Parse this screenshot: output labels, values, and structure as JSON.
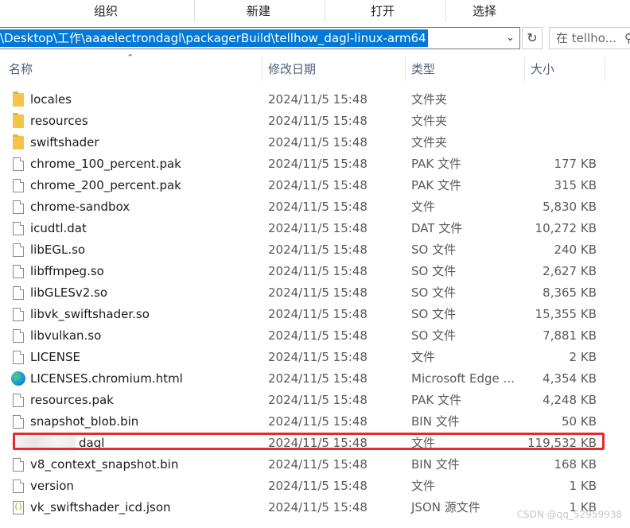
{
  "ribbon": {
    "groups": [
      "组织",
      "新建",
      "打开",
      "选择"
    ]
  },
  "address": {
    "path": "\\Desktop\\工作\\aaaelectrondagl\\packagerBuild\\tellhow_dagl-linux-arm64",
    "dropdown_icon": "chevron-down-icon",
    "refresh_icon": "refresh-icon",
    "search_placeholder": "在 tellho...",
    "search_icon": "search-icon"
  },
  "columns": {
    "name": "名称",
    "date": "修改日期",
    "type": "类型",
    "size": "大小"
  },
  "files": [
    {
      "name": "locales",
      "date": "2024/11/5 15:48",
      "type": "文件夹",
      "size": "",
      "icon": "folder"
    },
    {
      "name": "resources",
      "date": "2024/11/5 15:48",
      "type": "文件夹",
      "size": "",
      "icon": "folder"
    },
    {
      "name": "swiftshader",
      "date": "2024/11/5 15:48",
      "type": "文件夹",
      "size": "",
      "icon": "folder"
    },
    {
      "name": "chrome_100_percent.pak",
      "date": "2024/11/5 15:48",
      "type": "PAK 文件",
      "size": "177 KB",
      "icon": "file"
    },
    {
      "name": "chrome_200_percent.pak",
      "date": "2024/11/5 15:48",
      "type": "PAK 文件",
      "size": "315 KB",
      "icon": "file"
    },
    {
      "name": "chrome-sandbox",
      "date": "2024/11/5 15:48",
      "type": "文件",
      "size": "5,830 KB",
      "icon": "file"
    },
    {
      "name": "icudtl.dat",
      "date": "2024/11/5 15:48",
      "type": "DAT 文件",
      "size": "10,272 KB",
      "icon": "file"
    },
    {
      "name": "libEGL.so",
      "date": "2024/11/5 15:48",
      "type": "SO 文件",
      "size": "240 KB",
      "icon": "file"
    },
    {
      "name": "libffmpeg.so",
      "date": "2024/11/5 15:48",
      "type": "SO 文件",
      "size": "2,627 KB",
      "icon": "file"
    },
    {
      "name": "libGLESv2.so",
      "date": "2024/11/5 15:48",
      "type": "SO 文件",
      "size": "8,365 KB",
      "icon": "file"
    },
    {
      "name": "libvk_swiftshader.so",
      "date": "2024/11/5 15:48",
      "type": "SO 文件",
      "size": "15,355 KB",
      "icon": "file"
    },
    {
      "name": "libvulkan.so",
      "date": "2024/11/5 15:48",
      "type": "SO 文件",
      "size": "7,881 KB",
      "icon": "file"
    },
    {
      "name": "LICENSE",
      "date": "2024/11/5 15:48",
      "type": "文件",
      "size": "2 KB",
      "icon": "file"
    },
    {
      "name": "LICENSES.chromium.html",
      "date": "2024/11/5 15:48",
      "type": "Microsoft Edge ...",
      "size": "4,354 KB",
      "icon": "edge"
    },
    {
      "name": "resources.pak",
      "date": "2024/11/5 15:48",
      "type": "PAK 文件",
      "size": "4,248 KB",
      "icon": "file"
    },
    {
      "name": "snapshot_blob.bin",
      "date": "2024/11/5 15:48",
      "type": "BIN 文件",
      "size": "50 KB",
      "icon": "file"
    },
    {
      "name": "dagl",
      "date": "2024/11/5 15:48",
      "type": "文件",
      "size": "119,532 KB",
      "icon": "blurred"
    },
    {
      "name": "v8_context_snapshot.bin",
      "date": "2024/11/5 15:48",
      "type": "BIN 文件",
      "size": "168 KB",
      "icon": "file"
    },
    {
      "name": "version",
      "date": "2024/11/5 15:48",
      "type": "文件",
      "size": "1 KB",
      "icon": "file"
    },
    {
      "name": "vk_swiftshader_icd.json",
      "date": "2024/11/5 15:48",
      "type": "JSON 源文件",
      "size": "1 KB",
      "icon": "json"
    }
  ],
  "watermark": "CSDN @qq_52959938",
  "colors": {
    "selection": "#0078d7",
    "highlight_box": "#e8292b",
    "header_text": "#4c607a"
  }
}
